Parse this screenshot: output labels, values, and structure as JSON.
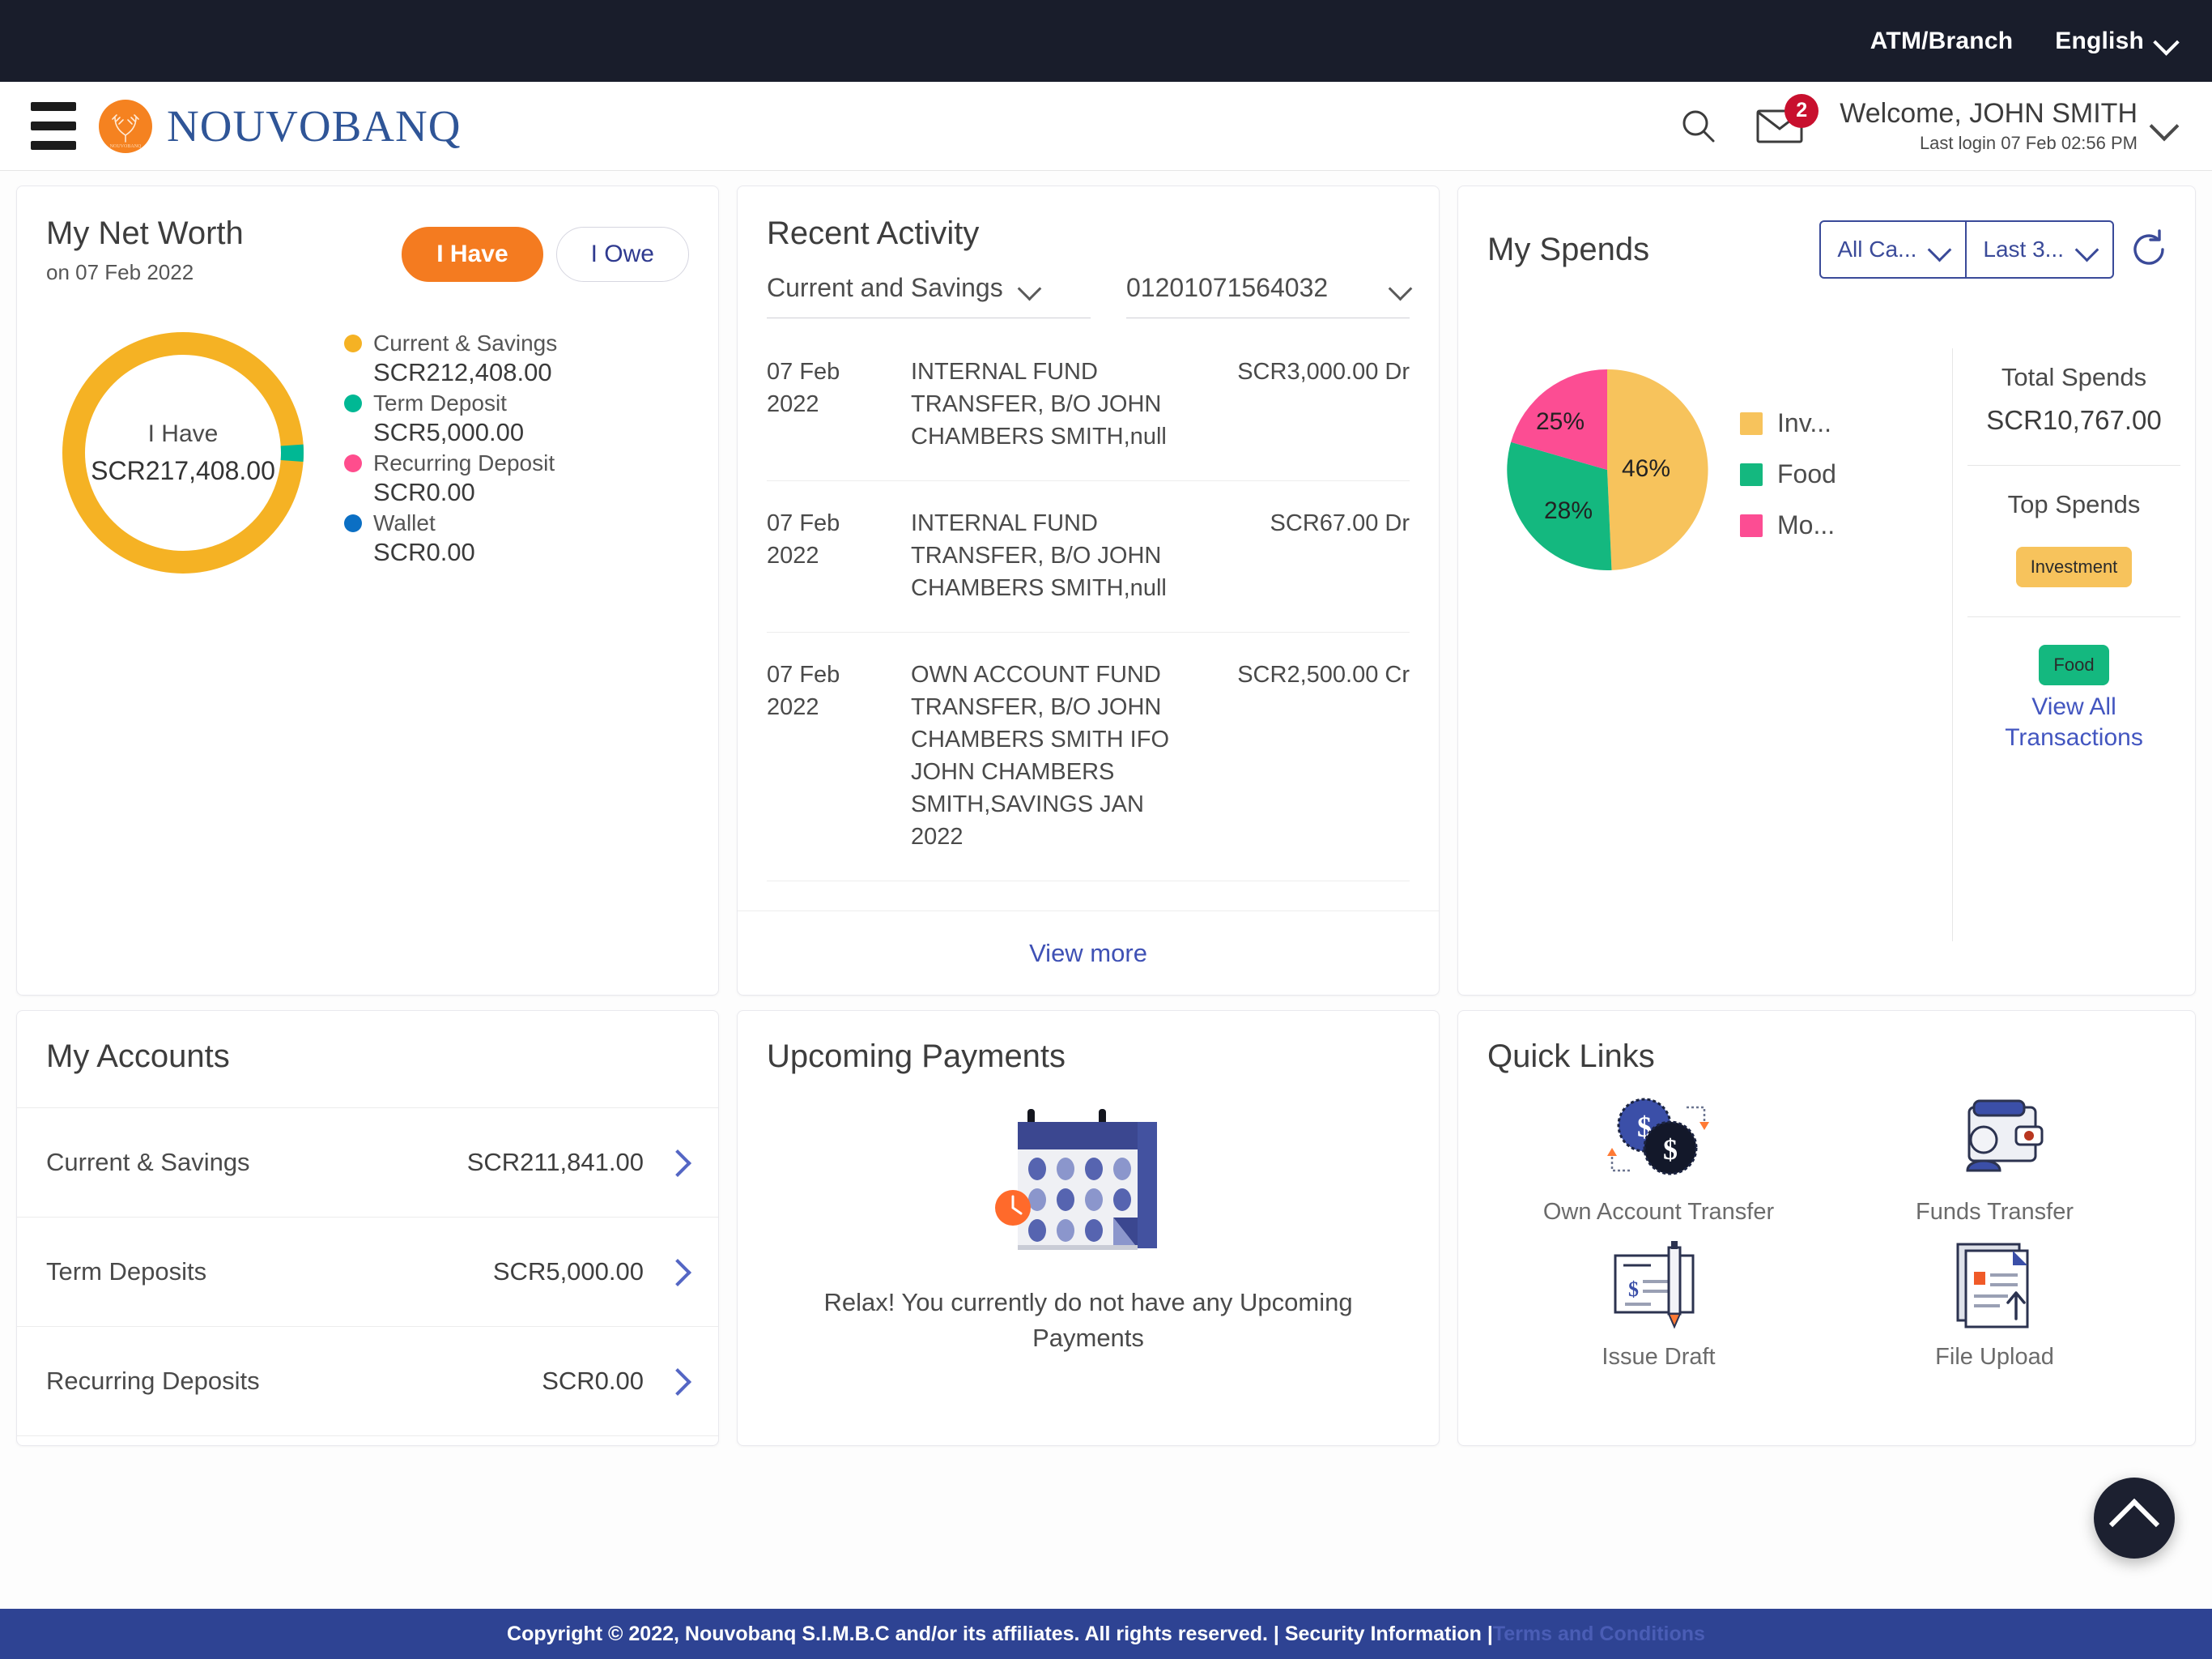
{
  "topbar": {
    "atm_branch": "ATM/Branch",
    "language": "English"
  },
  "header": {
    "brand_name": "NOUVOBANQ",
    "notifications_count": "2",
    "welcome": "Welcome, JOHN SMITH",
    "last_login": "Last login 07 Feb 02:56 PM"
  },
  "net_worth": {
    "title": "My Net Worth",
    "subtitle": "on 07 Feb 2022",
    "toggle_have": "I Have",
    "toggle_owe": "I Owe",
    "center_label": "I Have",
    "center_amount": "SCR217,408.00",
    "legend": [
      {
        "label": "Current & Savings",
        "amount": "SCR212,408.00",
        "color": "#f5b224"
      },
      {
        "label": "Term Deposit",
        "amount": "SCR5,000.00",
        "color": "#00b894"
      },
      {
        "label": "Recurring Deposit",
        "amount": "SCR0.00",
        "color": "#ff4d8d"
      },
      {
        "label": "Wallet",
        "amount": "SCR0.00",
        "color": "#0b6fc4"
      }
    ]
  },
  "recent_activity": {
    "title": "Recent Activity",
    "account_type": "Current and Savings",
    "account_number": "01201071564032",
    "view_more": "View more",
    "transactions": [
      {
        "date": "07 Feb 2022",
        "description": "INTERNAL FUND TRANSFER, B/O JOHN CHAMBERS SMITH,null",
        "amount": "SCR3,000.00 Dr"
      },
      {
        "date": "07 Feb 2022",
        "description": "INTERNAL FUND TRANSFER, B/O JOHN CHAMBERS SMITH,null",
        "amount": "SCR67.00 Dr"
      },
      {
        "date": "07 Feb 2022",
        "description": "OWN ACCOUNT FUND TRANSFER, B/O JOHN CHAMBERS SMITH IFO JOHN CHAMBERS SMITH,SAVINGS JAN 2022",
        "amount": "SCR2,500.00 Cr"
      }
    ]
  },
  "my_spends": {
    "title": "My Spends",
    "category_filter": "All Ca...",
    "period_filter": "Last 3...",
    "total_spends_label": "Total Spends",
    "total_spends_amount": "SCR10,767.00",
    "top_spends_label": "Top Spends",
    "chip_investment": "Investment",
    "chip_food": "Food",
    "view_all": "View All Transactions"
  },
  "chart_data": [
    {
      "type": "pie",
      "title": "My Net Worth",
      "subtitle": "on 07 Feb 2022",
      "categories": [
        "Current & Savings",
        "Term Deposit",
        "Recurring Deposit",
        "Wallet"
      ],
      "values": [
        212408.0,
        5000.0,
        0.0,
        0.0
      ],
      "percentages": [
        97.7,
        2.3,
        0.0,
        0.0
      ],
      "colors": [
        "#f5b224",
        "#00b894",
        "#ff4d8d",
        "#0b6fc4"
      ],
      "currency": "SCR",
      "total": 217408.0,
      "center_label": "I Have",
      "center_value": "SCR217,408.00",
      "legend_position": "right",
      "donut": true
    },
    {
      "type": "pie",
      "title": "My Spends",
      "categories": [
        "Investment",
        "Food",
        "Mo..."
      ],
      "legend_labels": [
        "Inv...",
        "Food",
        "Mo..."
      ],
      "values": [
        46,
        28,
        25
      ],
      "data_labels": [
        "46%",
        "28%",
        "25%"
      ],
      "colors": [
        "#f7c35c",
        "#14b87f",
        "#fc4d93"
      ],
      "total_label": "Total Spends",
      "total_value": "SCR10,767.00",
      "legend_position": "right",
      "donut": false
    }
  ],
  "my_accounts": {
    "title": "My Accounts",
    "rows": [
      {
        "name": "Current & Savings",
        "amount": "SCR211,841.00"
      },
      {
        "name": "Term Deposits",
        "amount": "SCR5,000.00"
      },
      {
        "name": "Recurring Deposits",
        "amount": "SCR0.00"
      }
    ]
  },
  "upcoming_payments": {
    "title": "Upcoming Payments",
    "empty_message": "Relax! You currently do not have any Upcoming Payments"
  },
  "quick_links": {
    "title": "Quick Links",
    "items": [
      {
        "label": "Own Account Transfer"
      },
      {
        "label": "Funds Transfer"
      },
      {
        "label": "Issue Draft"
      },
      {
        "label": "File Upload"
      }
    ]
  },
  "footer": {
    "copyright": "Copyright © 2022, Nouvobanq S.I.M.B.C and/or its affiliates. All rights reserved. | Security Information | ",
    "terms": "Terms and Conditions"
  }
}
